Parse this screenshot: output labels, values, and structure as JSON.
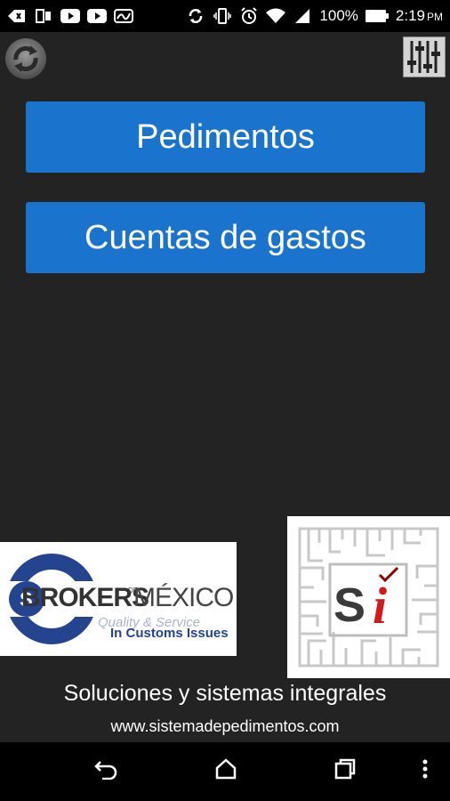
{
  "status_bar": {
    "battery_percent": "100%",
    "time": "2:19",
    "ampm": "PM",
    "icons": [
      "back-arrow-icon",
      "cast-icon",
      "youtube-icon",
      "youtube-icon",
      "signature-icon",
      "sync-icon",
      "vibrate-icon",
      "alarm-icon",
      "wifi-icon",
      "signal-icon",
      "battery-icon"
    ]
  },
  "toolbar": {
    "refresh_icon": "refresh-icon",
    "settings_icon": "sliders-icon"
  },
  "buttons": {
    "pedimentos": "Pedimentos",
    "cuentas": "Cuentas de gastos"
  },
  "logos": {
    "brokers": {
      "brand": "BROKERS",
      "small": "DE",
      "country": "MÉXICO",
      "tagline1": "Quality & Service",
      "tagline2": "In Customs Issues"
    },
    "si": {
      "letters": "Si"
    }
  },
  "footer": {
    "title": "Soluciones y sistemas integrales",
    "url": "www.sistemadepedimentos.com"
  },
  "nav_bar": {
    "icons": [
      "back-icon",
      "home-icon",
      "recents-icon",
      "more-icon"
    ]
  },
  "colors": {
    "button_blue": "#1a73cc",
    "background": "#232323",
    "brokers_blue": "#24448f",
    "si_red": "#d11a1a"
  }
}
